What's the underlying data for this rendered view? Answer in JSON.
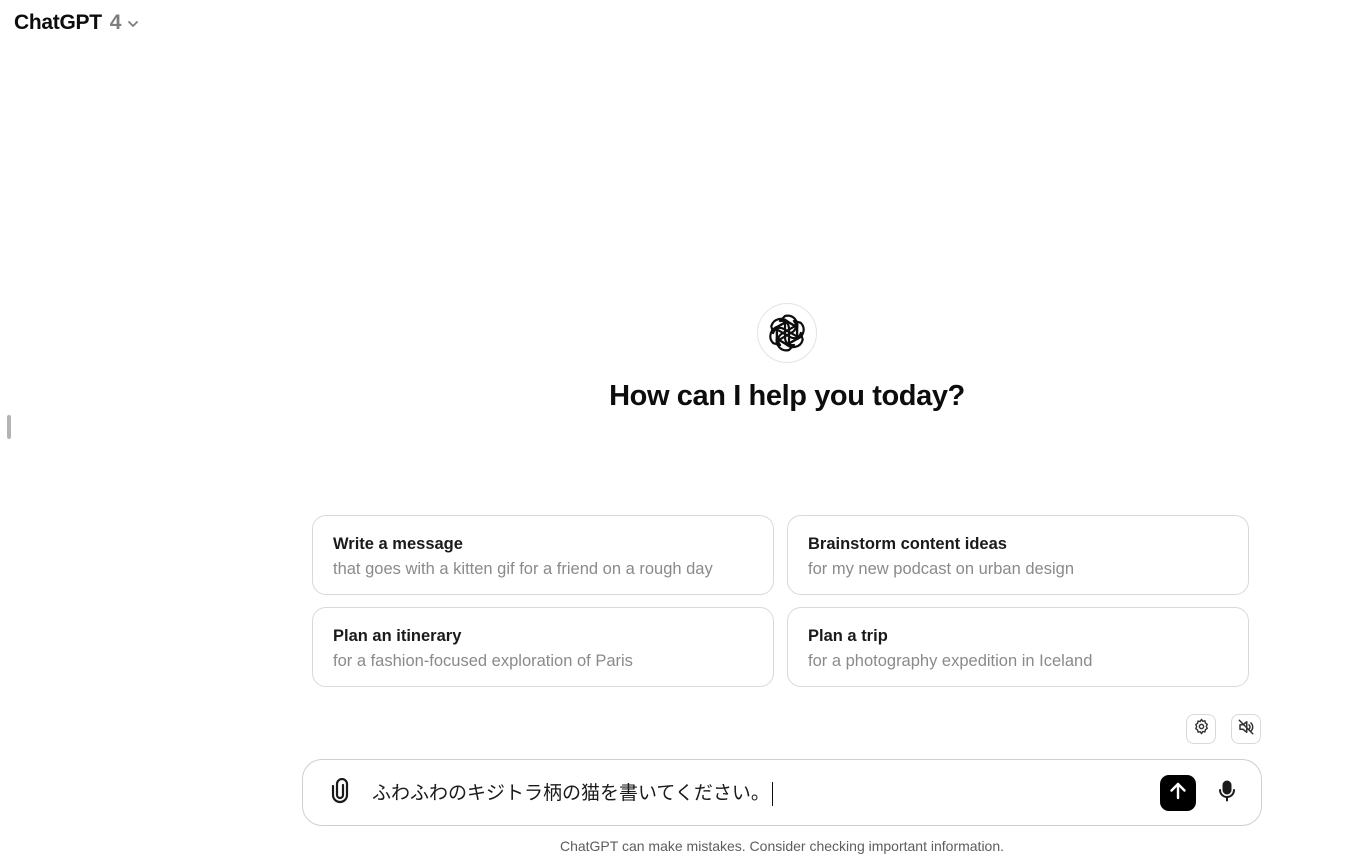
{
  "header": {
    "model_name": "ChatGPT",
    "model_version": "4"
  },
  "main": {
    "headline": "How can I help you today?",
    "suggestions": [
      {
        "title": "Write a message",
        "subtitle": "that goes with a kitten gif for a friend on a rough day"
      },
      {
        "title": "Brainstorm content ideas",
        "subtitle": "for my new podcast on urban design"
      },
      {
        "title": "Plan an itinerary",
        "subtitle": "for a fashion-focused exploration of Paris"
      },
      {
        "title": "Plan a trip",
        "subtitle": "for a photography expedition in Iceland"
      }
    ]
  },
  "composer": {
    "value": "ふわふわのキジトラ柄の猫を書いてください。"
  },
  "footer": {
    "disclaimer": "ChatGPT can make mistakes. Consider checking important information."
  },
  "colors": {
    "send_button_bg": "#000000",
    "muted_text": "#8a8a8a",
    "border": "#d9d9d9"
  },
  "icons": {
    "logo": "openai-logo-icon",
    "model_menu": "chevron-down-icon",
    "settings": "gear-icon",
    "speaker": "speaker-muted-icon",
    "attach": "paperclip-icon",
    "send": "arrow-up-icon",
    "voice": "microphone-icon"
  }
}
